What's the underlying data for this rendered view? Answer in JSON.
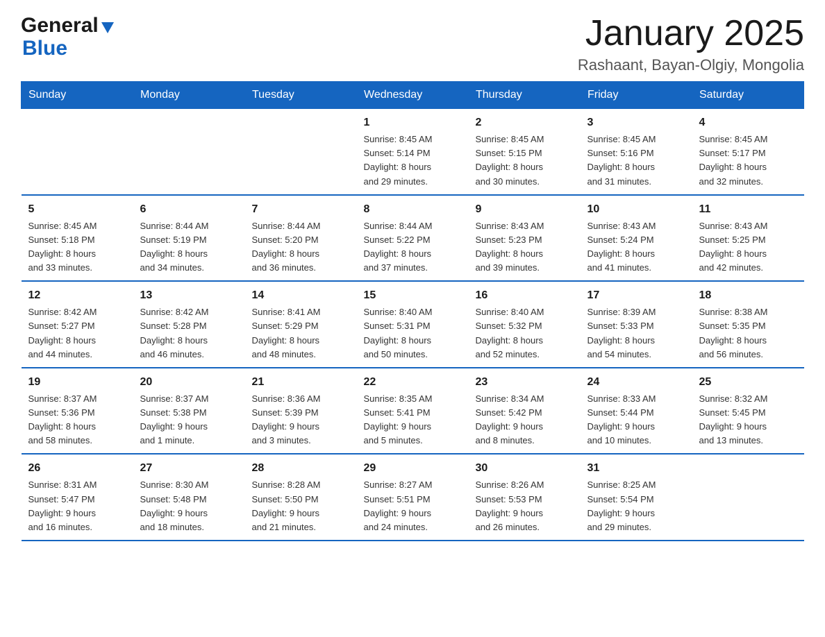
{
  "logo": {
    "general": "General",
    "blue": "Blue"
  },
  "title": {
    "month_year": "January 2025",
    "location": "Rashaant, Bayan-Olgiy, Mongolia"
  },
  "headers": [
    "Sunday",
    "Monday",
    "Tuesday",
    "Wednesday",
    "Thursday",
    "Friday",
    "Saturday"
  ],
  "weeks": [
    [
      {
        "day": "",
        "info": ""
      },
      {
        "day": "",
        "info": ""
      },
      {
        "day": "",
        "info": ""
      },
      {
        "day": "1",
        "info": "Sunrise: 8:45 AM\nSunset: 5:14 PM\nDaylight: 8 hours\nand 29 minutes."
      },
      {
        "day": "2",
        "info": "Sunrise: 8:45 AM\nSunset: 5:15 PM\nDaylight: 8 hours\nand 30 minutes."
      },
      {
        "day": "3",
        "info": "Sunrise: 8:45 AM\nSunset: 5:16 PM\nDaylight: 8 hours\nand 31 minutes."
      },
      {
        "day": "4",
        "info": "Sunrise: 8:45 AM\nSunset: 5:17 PM\nDaylight: 8 hours\nand 32 minutes."
      }
    ],
    [
      {
        "day": "5",
        "info": "Sunrise: 8:45 AM\nSunset: 5:18 PM\nDaylight: 8 hours\nand 33 minutes."
      },
      {
        "day": "6",
        "info": "Sunrise: 8:44 AM\nSunset: 5:19 PM\nDaylight: 8 hours\nand 34 minutes."
      },
      {
        "day": "7",
        "info": "Sunrise: 8:44 AM\nSunset: 5:20 PM\nDaylight: 8 hours\nand 36 minutes."
      },
      {
        "day": "8",
        "info": "Sunrise: 8:44 AM\nSunset: 5:22 PM\nDaylight: 8 hours\nand 37 minutes."
      },
      {
        "day": "9",
        "info": "Sunrise: 8:43 AM\nSunset: 5:23 PM\nDaylight: 8 hours\nand 39 minutes."
      },
      {
        "day": "10",
        "info": "Sunrise: 8:43 AM\nSunset: 5:24 PM\nDaylight: 8 hours\nand 41 minutes."
      },
      {
        "day": "11",
        "info": "Sunrise: 8:43 AM\nSunset: 5:25 PM\nDaylight: 8 hours\nand 42 minutes."
      }
    ],
    [
      {
        "day": "12",
        "info": "Sunrise: 8:42 AM\nSunset: 5:27 PM\nDaylight: 8 hours\nand 44 minutes."
      },
      {
        "day": "13",
        "info": "Sunrise: 8:42 AM\nSunset: 5:28 PM\nDaylight: 8 hours\nand 46 minutes."
      },
      {
        "day": "14",
        "info": "Sunrise: 8:41 AM\nSunset: 5:29 PM\nDaylight: 8 hours\nand 48 minutes."
      },
      {
        "day": "15",
        "info": "Sunrise: 8:40 AM\nSunset: 5:31 PM\nDaylight: 8 hours\nand 50 minutes."
      },
      {
        "day": "16",
        "info": "Sunrise: 8:40 AM\nSunset: 5:32 PM\nDaylight: 8 hours\nand 52 minutes."
      },
      {
        "day": "17",
        "info": "Sunrise: 8:39 AM\nSunset: 5:33 PM\nDaylight: 8 hours\nand 54 minutes."
      },
      {
        "day": "18",
        "info": "Sunrise: 8:38 AM\nSunset: 5:35 PM\nDaylight: 8 hours\nand 56 minutes."
      }
    ],
    [
      {
        "day": "19",
        "info": "Sunrise: 8:37 AM\nSunset: 5:36 PM\nDaylight: 8 hours\nand 58 minutes."
      },
      {
        "day": "20",
        "info": "Sunrise: 8:37 AM\nSunset: 5:38 PM\nDaylight: 9 hours\nand 1 minute."
      },
      {
        "day": "21",
        "info": "Sunrise: 8:36 AM\nSunset: 5:39 PM\nDaylight: 9 hours\nand 3 minutes."
      },
      {
        "day": "22",
        "info": "Sunrise: 8:35 AM\nSunset: 5:41 PM\nDaylight: 9 hours\nand 5 minutes."
      },
      {
        "day": "23",
        "info": "Sunrise: 8:34 AM\nSunset: 5:42 PM\nDaylight: 9 hours\nand 8 minutes."
      },
      {
        "day": "24",
        "info": "Sunrise: 8:33 AM\nSunset: 5:44 PM\nDaylight: 9 hours\nand 10 minutes."
      },
      {
        "day": "25",
        "info": "Sunrise: 8:32 AM\nSunset: 5:45 PM\nDaylight: 9 hours\nand 13 minutes."
      }
    ],
    [
      {
        "day": "26",
        "info": "Sunrise: 8:31 AM\nSunset: 5:47 PM\nDaylight: 9 hours\nand 16 minutes."
      },
      {
        "day": "27",
        "info": "Sunrise: 8:30 AM\nSunset: 5:48 PM\nDaylight: 9 hours\nand 18 minutes."
      },
      {
        "day": "28",
        "info": "Sunrise: 8:28 AM\nSunset: 5:50 PM\nDaylight: 9 hours\nand 21 minutes."
      },
      {
        "day": "29",
        "info": "Sunrise: 8:27 AM\nSunset: 5:51 PM\nDaylight: 9 hours\nand 24 minutes."
      },
      {
        "day": "30",
        "info": "Sunrise: 8:26 AM\nSunset: 5:53 PM\nDaylight: 9 hours\nand 26 minutes."
      },
      {
        "day": "31",
        "info": "Sunrise: 8:25 AM\nSunset: 5:54 PM\nDaylight: 9 hours\nand 29 minutes."
      },
      {
        "day": "",
        "info": ""
      }
    ]
  ]
}
